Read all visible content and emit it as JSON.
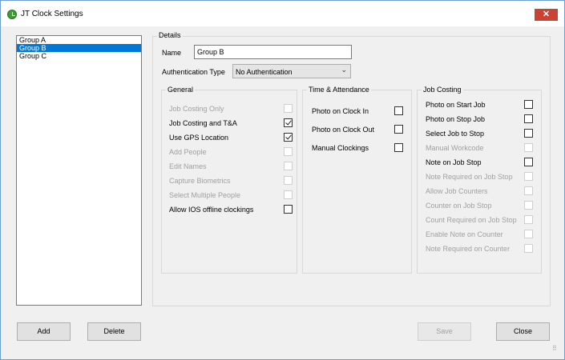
{
  "window": {
    "title": "JT Clock Settings",
    "close_glyph": "✕"
  },
  "groups": [
    "Group A",
    "Group B",
    "Group C"
  ],
  "selected_group": "Group B",
  "details": {
    "legend": "Details",
    "name_label": "Name",
    "name_value": "Group B",
    "auth_label": "Authentication Type",
    "auth_value": "No Authentication",
    "chevron": "⌄"
  },
  "general": {
    "legend": "General",
    "items": [
      {
        "label": "Job Costing Only",
        "checked": false,
        "enabled": false
      },
      {
        "label": "Job Costing and T&A",
        "checked": true,
        "enabled": true
      },
      {
        "label": "Use GPS Location",
        "checked": true,
        "enabled": true
      },
      {
        "label": "Add People",
        "checked": false,
        "enabled": false
      },
      {
        "label": "Edit Names",
        "checked": false,
        "enabled": false
      },
      {
        "label": "Capture Biometrics",
        "checked": false,
        "enabled": false
      },
      {
        "label": "Select Multiple People",
        "checked": false,
        "enabled": false
      },
      {
        "label": "Allow IOS offline clockings",
        "checked": false,
        "enabled": true
      }
    ]
  },
  "time_attendance": {
    "legend": "Time & Attendance",
    "items": [
      {
        "label": "Photo on Clock In",
        "checked": false,
        "enabled": true
      },
      {
        "label": "Photo on Clock Out",
        "checked": false,
        "enabled": true
      },
      {
        "label": "Manual Clockings",
        "checked": false,
        "enabled": true
      }
    ]
  },
  "job_costing": {
    "legend": "Job Costing",
    "items": [
      {
        "label": "Photo on Start Job",
        "checked": false,
        "enabled": true
      },
      {
        "label": "Photo on Stop Job",
        "checked": false,
        "enabled": true
      },
      {
        "label": "Select Job to Stop",
        "checked": false,
        "enabled": true
      },
      {
        "label": "Manual Workcode",
        "checked": false,
        "enabled": false
      },
      {
        "label": "Note on Job Stop",
        "checked": false,
        "enabled": true
      },
      {
        "label": "Note Required on Job Stop",
        "checked": false,
        "enabled": false
      },
      {
        "label": "Allow Job Counters",
        "checked": false,
        "enabled": false
      },
      {
        "label": "Counter on Job Stop",
        "checked": false,
        "enabled": false
      },
      {
        "label": "Count Required on Job Stop",
        "checked": false,
        "enabled": false
      },
      {
        "label": "Enable Note on Counter",
        "checked": false,
        "enabled": false
      },
      {
        "label": "Note Required on Counter",
        "checked": false,
        "enabled": false
      }
    ]
  },
  "buttons": {
    "add": "Add",
    "delete": "Delete",
    "save": "Save",
    "close": "Close",
    "save_enabled": false
  }
}
